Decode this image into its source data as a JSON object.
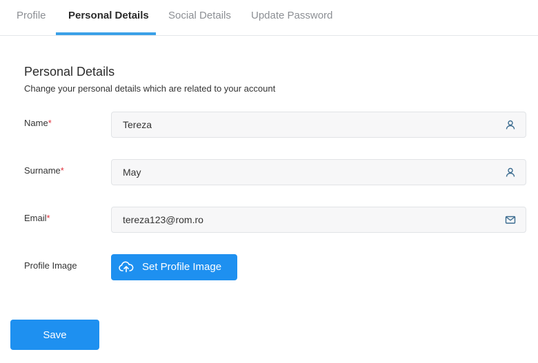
{
  "tabs": [
    {
      "label": "Profile",
      "active": false
    },
    {
      "label": "Personal Details",
      "active": true
    },
    {
      "label": "Social Details",
      "active": false
    },
    {
      "label": "Update Password",
      "active": false
    }
  ],
  "section": {
    "title": "Personal Details",
    "subtitle": "Change your personal details which are related to your account"
  },
  "fields": {
    "name": {
      "label": "Name",
      "required_mark": "*",
      "value": "Tereza",
      "icon": "user-icon"
    },
    "surname": {
      "label": "Surname",
      "required_mark": "*",
      "value": "May",
      "icon": "user-icon"
    },
    "email": {
      "label": "Email",
      "required_mark": "*",
      "value": "tereza123@rom.ro",
      "icon": "mail-icon"
    },
    "profile_image": {
      "label": "Profile Image",
      "button_label": "Set Profile Image",
      "icon": "cloud-upload-icon"
    }
  },
  "actions": {
    "save_label": "Save"
  },
  "colors": {
    "accent": "#1e90f0",
    "tab_underline": "#3aa0e8",
    "required": "#e0303a",
    "icon": "#3a6b8f"
  }
}
